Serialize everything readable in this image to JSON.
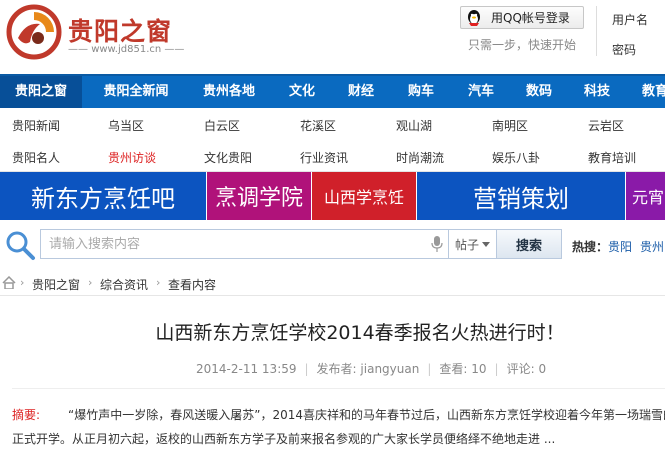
{
  "header": {
    "logo_title": "贵阳之窗",
    "logo_url_text": "www.jd851.cn",
    "qq_login": "用QQ帐号登录",
    "qq_tip": "只需一步，快速开始",
    "username_label": "用户名",
    "password_label": "密码"
  },
  "main_nav": [
    "贵阳之窗",
    "贵阳全新闻",
    "贵州各地",
    "文化",
    "财经",
    "购车",
    "汽车",
    "数码",
    "科技",
    "教育"
  ],
  "sub_nav": {
    "row1": [
      "贵阳新闻",
      "乌当区",
      "白云区",
      "花溪区",
      "观山湖",
      "南明区",
      "云岩区"
    ],
    "row2": [
      "贵阳名人",
      "贵州访谈",
      "文化贵阳",
      "行业资讯",
      "时尚潮流",
      "娱乐八卦",
      "教育培训"
    ]
  },
  "banners": [
    "新东方烹饪吧",
    "烹调学院",
    "山西学烹饪",
    "营销策划",
    "元宵"
  ],
  "search": {
    "placeholder": "请输入搜索内容",
    "scope": "帖子",
    "button": "搜索",
    "hot_label": "热搜：",
    "hot_links": [
      "贵阳",
      "贵州"
    ]
  },
  "breadcrumb": [
    "贵阳之窗",
    "综合资讯",
    "查看内容"
  ],
  "article": {
    "title": "山西新东方烹饪学校2014春季报名火热进行时！",
    "date": "2014-2-11 13:59",
    "publisher_label": "发布者:",
    "publisher": "jiangyuan",
    "views_label": "查看:",
    "views": "10",
    "comments_label": "评论:",
    "comments": "0",
    "abstract_label": "摘要:",
    "abstract_line1": "“爆竹声中一岁除，春风送暖入屠苏”，2014喜庆祥和的马年春节过后，山西新东方烹饪学校迎着今年第一场瑞雪的到来",
    "abstract_line2": "正式开学。从正月初六起，返校的山西新东方学子及前来报名参观的广大家长学员便络绎不绝地走进 ..."
  },
  "colors": {
    "nav_blue": "#0a6ac0",
    "banner_blue": "#0c54c0",
    "banner_magenta": "#b0127a",
    "banner_red": "#d0202a",
    "banner_purple": "#8a1aa8",
    "logo_red": "#c0392b"
  }
}
